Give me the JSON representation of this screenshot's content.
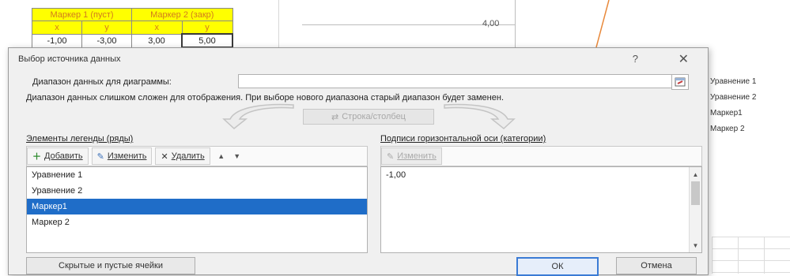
{
  "sheet": {
    "header": [
      "Маркер 1 (пуст)",
      "Маркер 2 (закр)"
    ],
    "subheader": [
      "x",
      "y",
      "x",
      "y"
    ],
    "row": [
      "-1,00",
      "-3,00",
      "3,00",
      "5,00"
    ]
  },
  "chart": {
    "ytick": "4,00",
    "curve_color": "#e8883a",
    "legend": [
      "Уравнение 1",
      "Уравнение 2",
      "Маркер1",
      "Маркер 2"
    ]
  },
  "dialog": {
    "title": "Выбор источника данных",
    "help": "?",
    "close": "✕",
    "range_label": "Диапазон данных для диаграммы:",
    "range_value": "",
    "warning": "Диапазон данных слишком сложен для отображения. При выборе нового диапазона старый диапазон будет заменен.",
    "switch_label": "Строка/столбец",
    "legend_group_label": "Элементы легенды (ряды)",
    "legend_toolbar": {
      "add": "Добавить",
      "edit": "Изменить",
      "delete": "Удалить"
    },
    "series": [
      "Уравнение 1",
      "Уравнение 2",
      "Маркер1",
      "Маркер 2"
    ],
    "selected_series": "Маркер1",
    "axis_group_label": "Подписи горизонтальной оси (категории)",
    "axis_toolbar": {
      "edit": "Изменить"
    },
    "axis_items": [
      "-1,00"
    ],
    "hidden_cells": "Скрытые и пустые ячейки",
    "ok": "ОК",
    "cancel": "Отмена"
  },
  "colors": {
    "accent": "#1f6dc8",
    "header_fill": "#ffff00",
    "header_text": "#d27a1e"
  }
}
